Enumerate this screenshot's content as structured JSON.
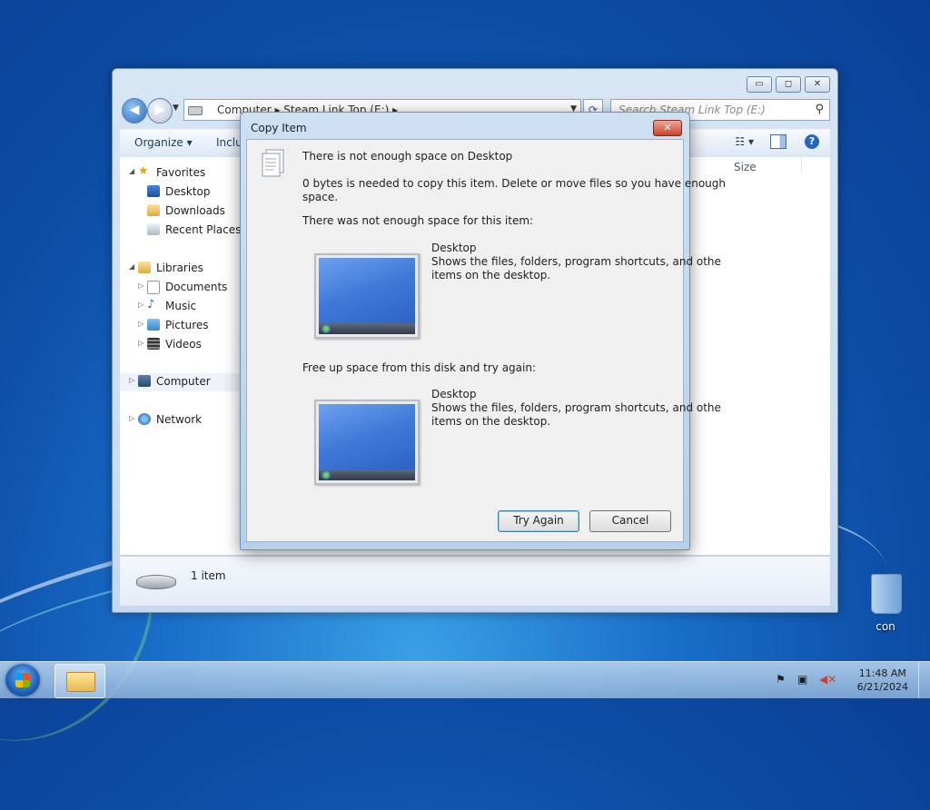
{
  "explorer": {
    "address_path": [
      "Computer",
      "Steam Link Top (E:)"
    ],
    "address_text": "Computer  ▸  Steam Link Top (E:)  ▸",
    "search_placeholder": "Search Steam Link Top (E:)",
    "toolbar": {
      "organize": "Organize ▾",
      "include": "Inclu",
      "view": "☷ ▾"
    },
    "window_controls": [
      "minimize",
      "maximize",
      "close"
    ],
    "nav": {
      "favorites": {
        "label": "Favorites",
        "items": [
          "Desktop",
          "Downloads",
          "Recent Places"
        ]
      },
      "libraries": {
        "label": "Libraries",
        "items": [
          "Documents",
          "Music",
          "Pictures",
          "Videos"
        ]
      },
      "computer": "Computer",
      "network": "Network"
    },
    "column_header": "Size",
    "details": {
      "item_count": "1 item"
    }
  },
  "dialog": {
    "title": "Copy Item",
    "heading": "There is not enough space on Desktop",
    "message_line1": "0 bytes is needed to copy this item. Delete or move files so you have enough",
    "message_line2": "space.",
    "section1_label": "There was not enough space for this item:",
    "item1": {
      "name": "Desktop",
      "desc_line1": "Shows the files, folders, program shortcuts, and othe",
      "desc_line2": "items on the desktop."
    },
    "section2_label": "Free up space from this disk and try again:",
    "item2": {
      "name": "Desktop",
      "desc_line1": "Shows the files, folders, program shortcuts, and othe",
      "desc_line2": "items on the desktop."
    },
    "buttons": {
      "try_again": "Try Again",
      "cancel": "Cancel"
    }
  },
  "desktop": {
    "recycle_bin_label": "con"
  },
  "taskbar": {
    "time": "11:48 AM",
    "date": "6/21/2024"
  },
  "colors": {
    "desktop_blue": "#1a6fc9",
    "dialog_frame": "#b8cfe9",
    "close_red": "#c9432b"
  }
}
